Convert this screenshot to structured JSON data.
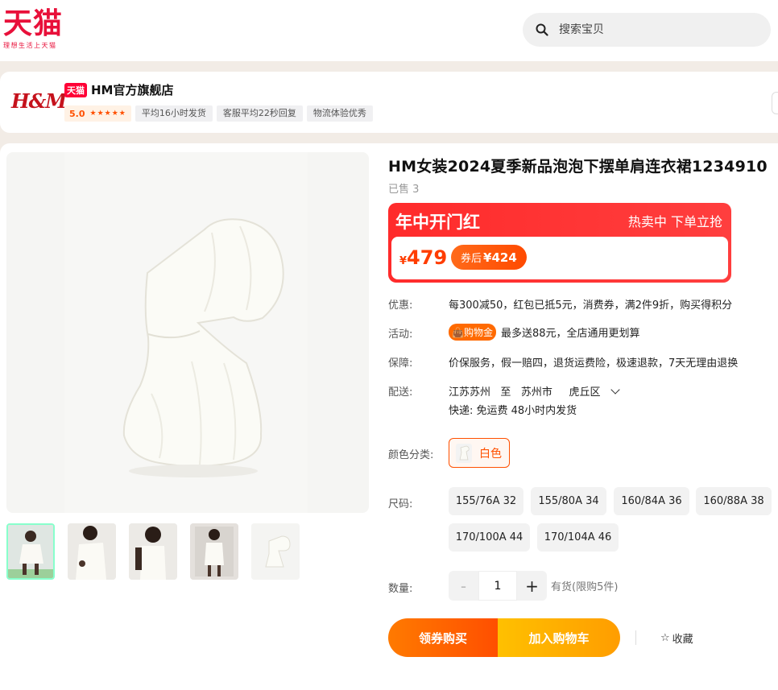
{
  "header": {
    "logo_main": "天猫",
    "logo_sub": "理想生活上天猫",
    "search_placeholder": "搜索宝贝"
  },
  "shop": {
    "logo_text": "H&M",
    "badge": "天猫",
    "name": "HM官方旗舰店",
    "rating": "5.0",
    "stars": "★★★★★",
    "tags": [
      "平均16小时发货",
      "客服平均22秒回复",
      "物流体验优秀"
    ]
  },
  "product": {
    "title": "HM女装2024夏季新品泡泡下摆单肩连衣裙1234910",
    "sold": "已售 3",
    "promo_title": "年中开门红",
    "promo_sub": "热卖中 下单立抢",
    "currency": "¥",
    "price": "479",
    "coupon_prefix": "券后",
    "coupon_price": "¥424",
    "rows": {
      "discount_label": "优惠:",
      "discount_value": "每300减50，红包已抵5元，消费券，满2件9折，购买得积分",
      "activity_label": "活动:",
      "activity_badge": "购物金",
      "activity_value": "最多送88元，全店通用更划算",
      "guarantee_label": "保障:",
      "guarantee_value": "价保服务，假一赔四，退货运费险，极速退款，7天无理由退换",
      "delivery_label": "配送:",
      "delivery_from": "江苏苏州",
      "delivery_to_word": "至",
      "delivery_city": "苏州市",
      "delivery_district": "虎丘区",
      "delivery_detail": "快递: 免运费  48小时内发货"
    },
    "color_label": "颜色分类:",
    "color_option": "白色",
    "size_label": "尺码:",
    "sizes": [
      "155/76A 32",
      "155/80A 34",
      "160/84A 36",
      "160/88A 38",
      "170/100A 44",
      "170/104A 46"
    ],
    "qty_label": "数量:",
    "qty_minus": "-",
    "qty_value": "1",
    "qty_plus": "+",
    "stock": "有货(限购5件)",
    "buy_label": "领券购买",
    "cart_label": "加入购物车",
    "fav_label": "收藏"
  },
  "colors": {
    "tmall_red": "#e8103a",
    "accent_orange": "#ff5000",
    "promo_red": "#ff2b2b"
  }
}
